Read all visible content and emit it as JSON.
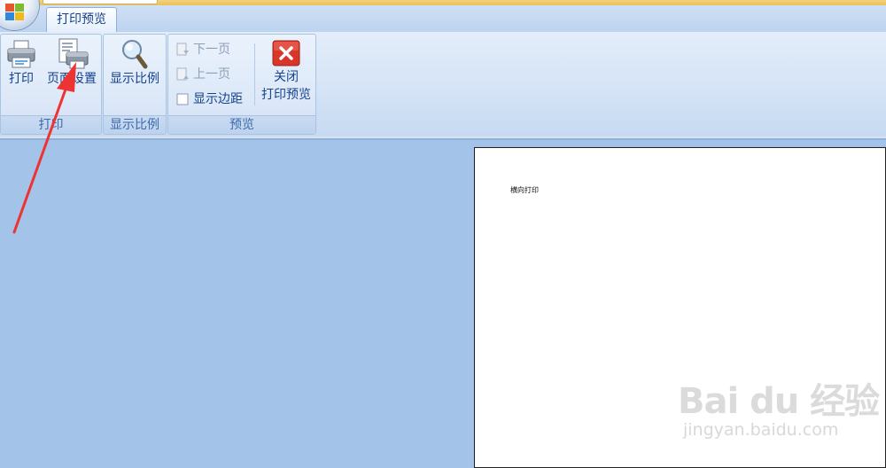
{
  "tabs": [
    {
      "label": "打印预览"
    }
  ],
  "ribbon": {
    "groups": {
      "print": {
        "label": "打印",
        "print_button": "打印",
        "page_setup_button": "页面设置"
      },
      "zoom": {
        "label": "显示比例",
        "zoom_button": "显示比例"
      },
      "preview": {
        "label": "预览",
        "next_page": "下一页",
        "prev_page": "上一页",
        "show_margins": "显示边距",
        "close_line1": "关闭",
        "close_line2": "打印预览"
      }
    }
  },
  "document": {
    "page_text": "横向打印"
  },
  "watermark": {
    "brand": "Bai du 经验",
    "url": "jingyan.baidu.com"
  },
  "colors": {
    "accent_text": "#15428b",
    "ribbon_bg": "#dce8f8",
    "workspace_bg": "#a4c3e8",
    "annotation_arrow": "#ee3333",
    "close_button": "#d9362a"
  },
  "icons": [
    "office-logo-icon",
    "printer-icon",
    "page-setup-icon",
    "magnifier-icon",
    "next-page-icon",
    "prev-page-icon",
    "checkbox-icon",
    "close-preview-icon"
  ]
}
